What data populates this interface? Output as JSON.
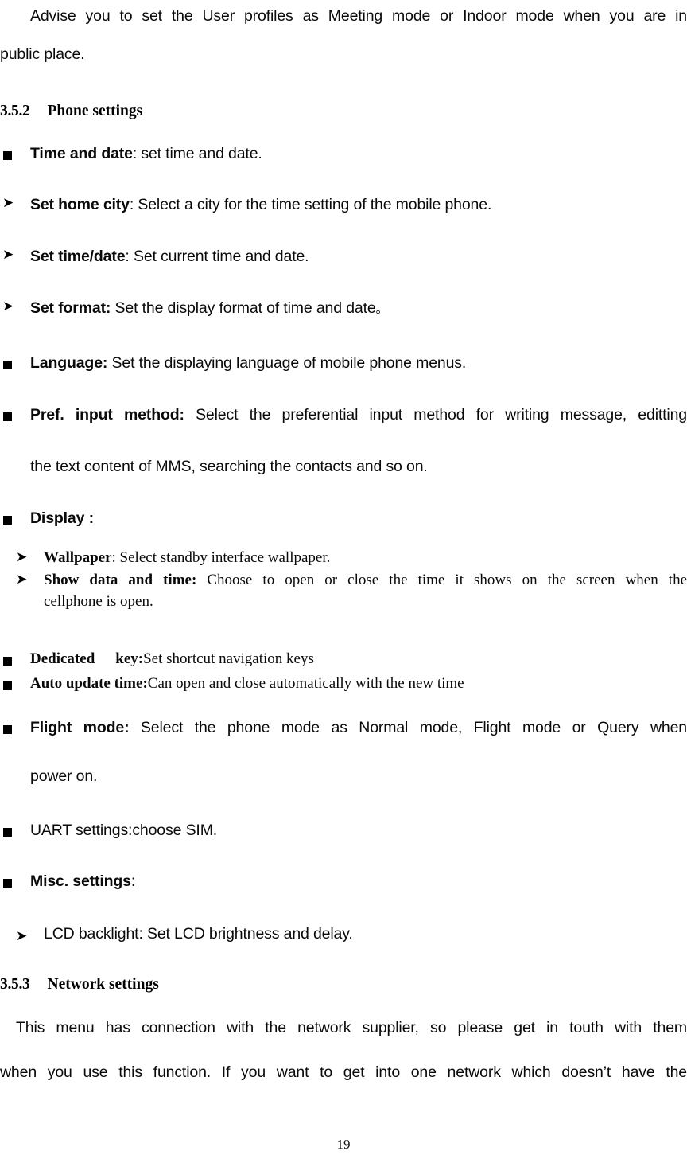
{
  "page": {
    "folio": "19"
  },
  "intro": {
    "line1": "Advise you to set the User profiles as Meeting mode or Indoor mode when you are in",
    "line2": "public place."
  },
  "section_phone": {
    "number": "3.5.2",
    "title": "Phone settings"
  },
  "items": {
    "time_and_date": {
      "term": "Time and date",
      "rest": ": set time and date."
    },
    "set_home_city": {
      "term": "Set home city",
      "rest": ": Select a city for the time setting of the mobile phone."
    },
    "set_time_date": {
      "term": "Set time/date",
      "rest": ": Set current time and date."
    },
    "set_format": {
      "term": "Set format:",
      "rest": " Set the display format of time and date",
      "tail": "。"
    },
    "language": {
      "term": "Language:",
      "rest": " Set the displaying language of mobile phone menus."
    },
    "pref_input_method": {
      "term": "Pref. input method:",
      "rest": " Select the preferential input method for writing message, editting",
      "line2": "the text content of MMS, searching the contacts and so on."
    },
    "display": {
      "term": "Display :"
    },
    "wallpaper": {
      "term": "Wallpaper",
      "rest": ": Select standby interface wallpaper."
    },
    "show_data_and_time": {
      "term": "Show data and time:",
      "rest": " Choose to open or close the time it shows on the screen when the",
      "line2": "cellphone is open."
    },
    "dedicated_key": {
      "term_a": "Dedicated",
      "term_b": "key:",
      "rest": "Set shortcut navigation keys"
    },
    "auto_update_time": {
      "term": "Auto update time:",
      "rest": "Can open and close automatically with the new time"
    },
    "flight_mode": {
      "term": "Flight mode:",
      "rest": " Select the phone mode as Normal mode, Flight mode or Query when",
      "line2": "power on."
    },
    "uart_settings": {
      "text": "UART settings:choose SIM."
    },
    "misc_settings": {
      "term": "Misc. settings",
      "rest": ":"
    },
    "lcd_backlight": {
      "text": "LCD backlight: Set LCD brightness and delay."
    }
  },
  "section_network": {
    "number": "3.5.3",
    "title": "Network settings",
    "para_line1": "This menu has connection with the network supplier, so please get in touth with them",
    "para_line2": "when you use this function. If you want to get into one network which doesn’t have the"
  },
  "icons": {
    "square_bullet": "square-bullet",
    "arrow_bullet": "arrow-bullet"
  }
}
